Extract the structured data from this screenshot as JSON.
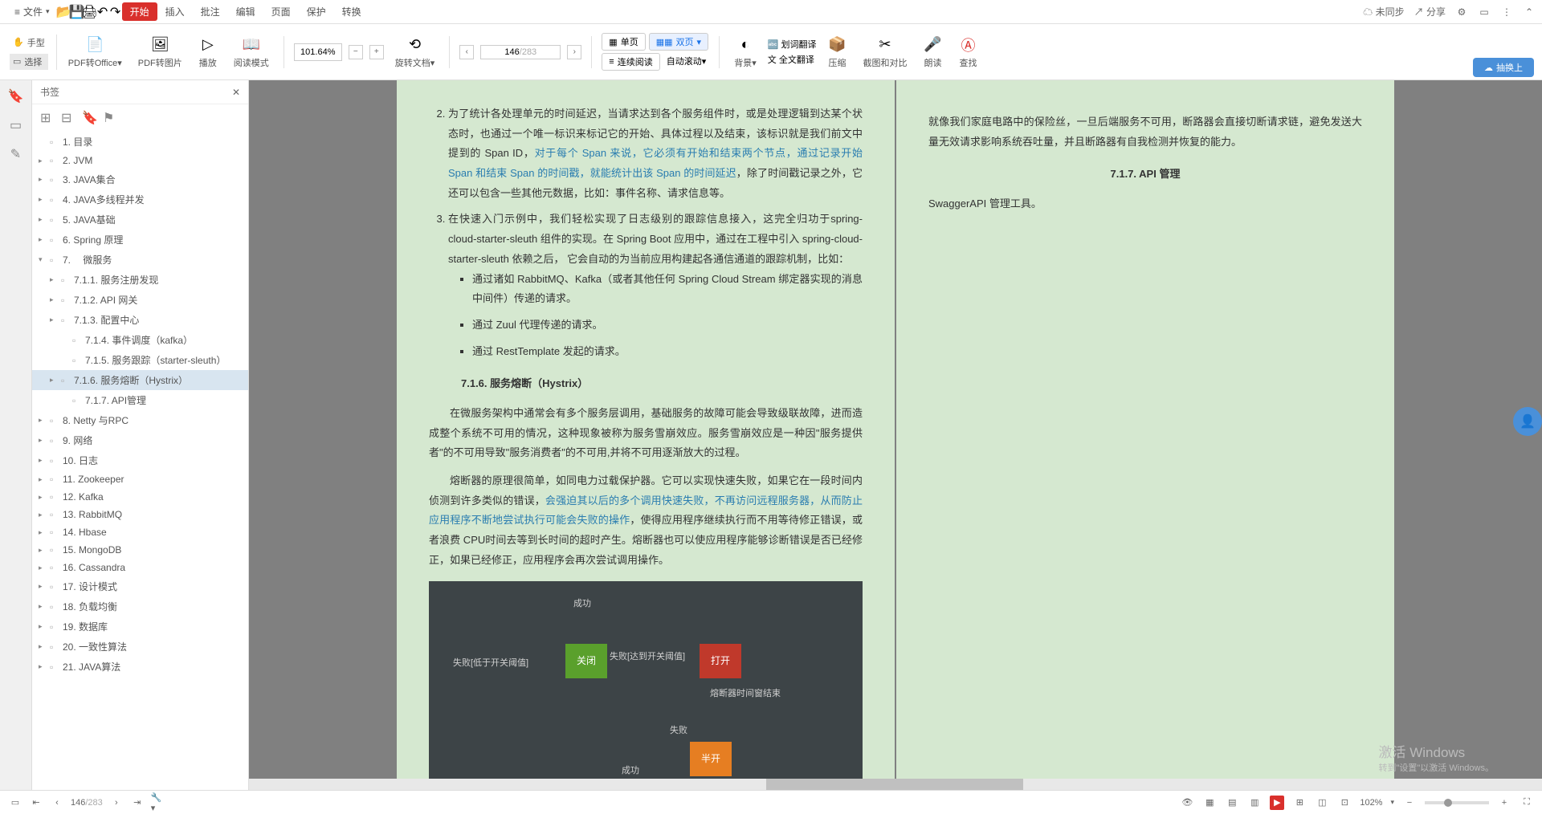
{
  "titlebar": {
    "file": "文件",
    "menus": [
      "插入",
      "批注",
      "编辑",
      "页面",
      "保护",
      "转换"
    ],
    "start": "开始",
    "unsync": "未同步",
    "share": "分享"
  },
  "toolbar": {
    "hand": "手型",
    "select": "选择",
    "pdf_to_office": "PDF转Office",
    "pdf_to_image": "PDF转图片",
    "play": "播放",
    "reading_mode": "阅读模式",
    "zoom": "101.64%",
    "rotate": "旋转文档",
    "page_current": "146",
    "page_total": "/283",
    "single": "单页",
    "double": "双页",
    "continuous": "连续阅读",
    "auto_scroll": "自动滚动",
    "background": "背景",
    "word_trans": "划词翻译",
    "full_trans": "全文翻译",
    "compress": "压缩",
    "screenshot": "截图和对比",
    "read_aloud": "朗读",
    "find": "查找",
    "swap": "抽换上"
  },
  "bookmarks": {
    "title": "书签",
    "items": [
      {
        "label": "1. 目录",
        "level": 1,
        "arrow": false
      },
      {
        "label": "2. JVM",
        "level": 1,
        "arrow": true
      },
      {
        "label": "3. JAVA集合",
        "level": 1,
        "arrow": true
      },
      {
        "label": "4. JAVA多线程并发",
        "level": 1,
        "arrow": true
      },
      {
        "label": "5. JAVA基础",
        "level": 1,
        "arrow": true
      },
      {
        "label": "6. Spring 原理",
        "level": 1,
        "arrow": true
      },
      {
        "label": "7. 　微服务",
        "level": 1,
        "arrow": true,
        "expanded": true
      },
      {
        "label": "7.1.1. 服务注册发现",
        "level": 2,
        "arrow": true
      },
      {
        "label": "7.1.2. API 网关",
        "level": 2,
        "arrow": true
      },
      {
        "label": "7.1.3. 配置中心",
        "level": 2,
        "arrow": true
      },
      {
        "label": "7.1.4. 事件调度（kafka）",
        "level": 3,
        "arrow": false
      },
      {
        "label": "7.1.5. 服务跟踪（starter-sleuth）",
        "level": 3,
        "arrow": false
      },
      {
        "label": "7.1.6. 服务熔断（Hystrix）",
        "level": 2,
        "arrow": true,
        "selected": true
      },
      {
        "label": "7.1.7. API管理",
        "level": 3,
        "arrow": false
      },
      {
        "label": "8. Netty 与RPC",
        "level": 1,
        "arrow": true
      },
      {
        "label": "9. 网络",
        "level": 1,
        "arrow": true
      },
      {
        "label": "10. 日志",
        "level": 1,
        "arrow": true
      },
      {
        "label": "11. Zookeeper",
        "level": 1,
        "arrow": true
      },
      {
        "label": "12. Kafka",
        "level": 1,
        "arrow": true
      },
      {
        "label": "13. RabbitMQ",
        "level": 1,
        "arrow": true
      },
      {
        "label": "14. Hbase",
        "level": 1,
        "arrow": true
      },
      {
        "label": "15. MongoDB",
        "level": 1,
        "arrow": true
      },
      {
        "label": "16. Cassandra",
        "level": 1,
        "arrow": true
      },
      {
        "label": "17. 设计模式",
        "level": 1,
        "arrow": true
      },
      {
        "label": "18. 负载均衡",
        "level": 1,
        "arrow": true
      },
      {
        "label": "19. 数据库",
        "level": 1,
        "arrow": true
      },
      {
        "label": "20. 一致性算法",
        "level": 1,
        "arrow": true
      },
      {
        "label": "21. JAVA算法",
        "level": 1,
        "arrow": true
      }
    ]
  },
  "content": {
    "li2": "为了统计各处理单元的时间延迟，当请求达到各个服务组件时，或是处理逻辑到达某个状态时，也通过一个唯一标识来标记它的开始、具体过程以及结束，该标识就是我们前文中提到的 Span ID，",
    "li2_link": "对于每个 Span 来说，它必须有开始和结束两个节点，通过记录开始 Span 和结束 Span 的时间戳，就能统计出该 Span 的时间延迟",
    "li2_end": "，除了时间戳记录之外，它还可以包含一些其他元数据，比如：事件名称、请求信息等。",
    "li3": "在快速入门示例中，我们轻松实现了日志级别的跟踪信息接入，这完全归功于spring-cloud-starter-sleuth 组件的实现。在 Spring Boot 应用中，通过在工程中引入 spring-cloud-starter-sleuth 依赖之后， 它会自动的为当前应用构建起各通信通道的跟踪机制，比如：",
    "sub1": "通过诸如 RabbitMQ、Kafka（或者其他任何 Spring Cloud Stream 绑定器实现的消息中间件）传递的请求。",
    "sub2": "通过 Zuul 代理传递的请求。",
    "sub3": "通过 RestTemplate 发起的请求。",
    "section716": "7.1.6. 服务熔断（Hystrix）",
    "p1": "在微服务架构中通常会有多个服务层调用，基础服务的故障可能会导致级联故障，进而造成整个系统不可用的情况，这种现象被称为服务雪崩效应。服务雪崩效应是一种因\"服务提供者\"的不可用导致\"服务消费者\"的不可用,并将不可用逐渐放大的过程。",
    "p2a": "熔断器的原理很简单，如同电力过载保护器。它可以实现快速失败，如果它在一段时间内侦测到许多类似的错误，",
    "p2_link": "会强迫其以后的多个调用快速失败，不再访问远程服务器，从而防止应用程序不断地尝试执行可能会失败的操作",
    "p2b": "，使得应用程序继续执行而不用等待修正错误，或者浪费 CPU时间去等到长时间的超时产生。熔断器也可以使应用程序能够诊断错误是否已经修正，如果已经修正，应用程序会再次尝试调用操作。",
    "right_p1": "就像我们家庭电路中的保险丝，一旦后端服务不可用，断路器会直接切断请求链，避免发送大量无效请求影响系统吞吐量，并且断路器有自我检测并恢复的能力。",
    "section717": "7.1.7. API 管理",
    "right_p2": "SwaggerAPI 管理工具。",
    "diagram": {
      "success": "成功",
      "closed": "关闭",
      "open": "打开",
      "half_open": "半开",
      "fail": "失败",
      "fail_low": "失败[低于开关阈值]",
      "fail_reach": "失败[达到开关阈值]",
      "timer_end": "熔断器时间窗结束"
    }
  },
  "statusbar": {
    "page_current": "146",
    "page_total": "/283",
    "zoom": "102%"
  },
  "watermark": {
    "main": "激活 Windows",
    "sub": "转到\"设置\"以激活 Windows。"
  }
}
